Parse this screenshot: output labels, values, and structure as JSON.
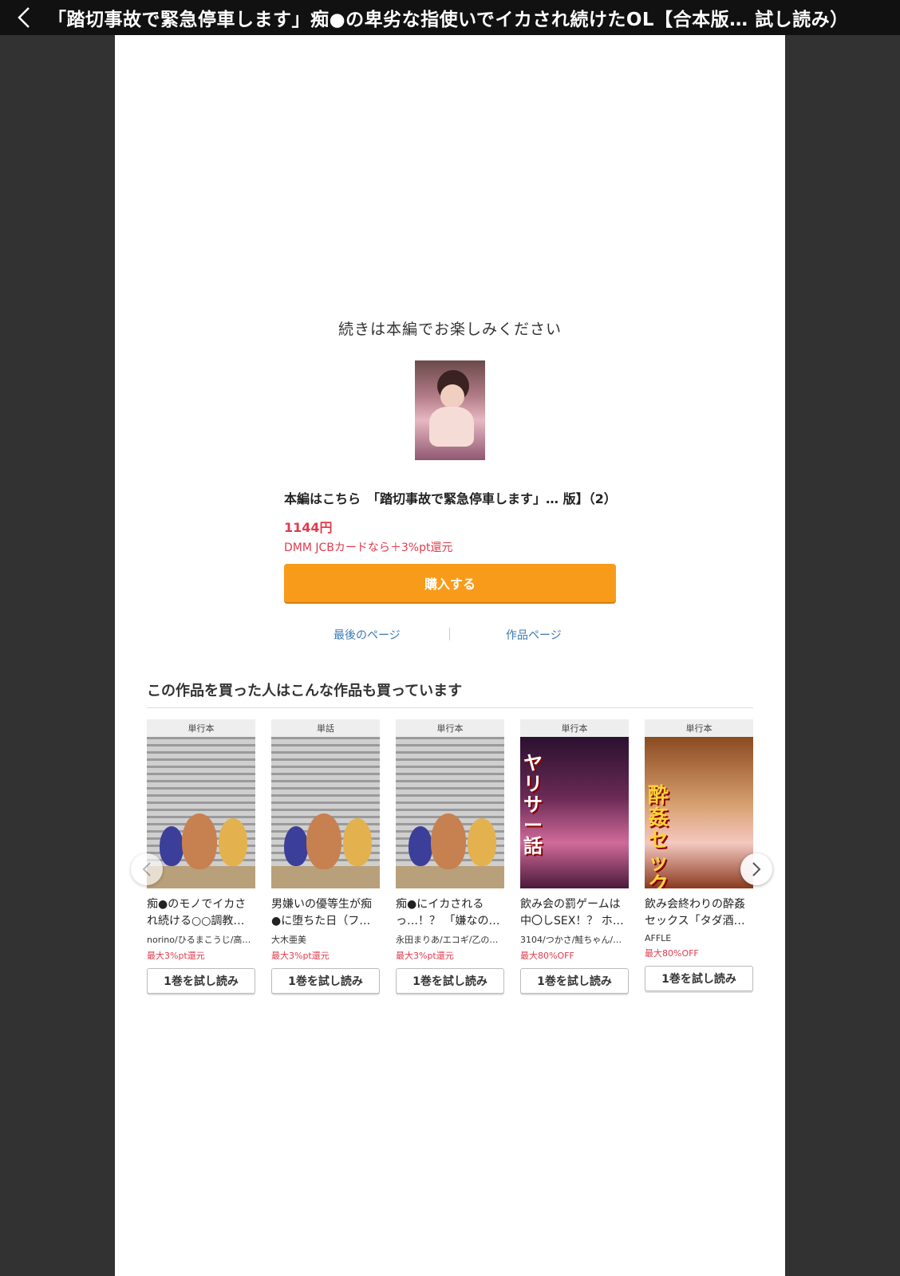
{
  "header": {
    "title": "「踏切事故で緊急停車します」痴●の卑劣な指使いでイカされ続けたOL【合本版…  試し読み）"
  },
  "reader_end": {
    "continue_message": "続きは本編でお楽しみください",
    "product_line": "本編はこちら　「踏切事故で緊急停車します」… 版】（2）",
    "price": "1144円",
    "cashback": "DMM JCBカードなら＋3%pt還元",
    "buy_label": "購入する",
    "last_page_label": "最後のページ",
    "work_page_label": "作品ページ"
  },
  "recommendations": {
    "title": "この作品を買った人はこんな作品も買っています",
    "items": [
      {
        "type": "単行本",
        "name": "痴●のモノでイカされ続ける○○調教…",
        "author": "norino/ひるまこうじ/高…",
        "promo": "最大3%pt還元",
        "trial": "1巻を試し読み"
      },
      {
        "type": "単話",
        "name": "男嫌いの優等生が痴●に堕ちた日（フ…",
        "author": "大木亜美",
        "promo": "最大3%pt還元",
        "trial": "1巻を試し読み"
      },
      {
        "type": "単行本",
        "name": "痴●にイカされるっ…！？ 「嫌なの…",
        "author": "永田まりあ/エコギ/乙の…",
        "promo": "最大3%pt還元",
        "trial": "1巻を試し読み"
      },
      {
        "type": "単行本",
        "name": "飲み会の罰ゲームは中〇しSEX！？ ホ…",
        "author": "3104/つかさ/鮭ちゃん/…",
        "promo": "最大80%OFF",
        "trial": "1巻を試し読み"
      },
      {
        "type": "単行本",
        "name": "飲み会終わりの酔姦セックス「タダ酒…",
        "author": "AFFLE",
        "promo": "最大80%OFF",
        "trial": "1巻を試し読み"
      }
    ],
    "cover4_text": "ヤリサー話",
    "cover5_text": "酔姦セックス"
  },
  "icons": {
    "back": "chevron-left-icon",
    "prev": "chevron-left-icon",
    "next": "chevron-right-icon"
  },
  "colors": {
    "accent": "#f99b1a",
    "price": "#e03b4d",
    "link": "#3a79b5"
  }
}
